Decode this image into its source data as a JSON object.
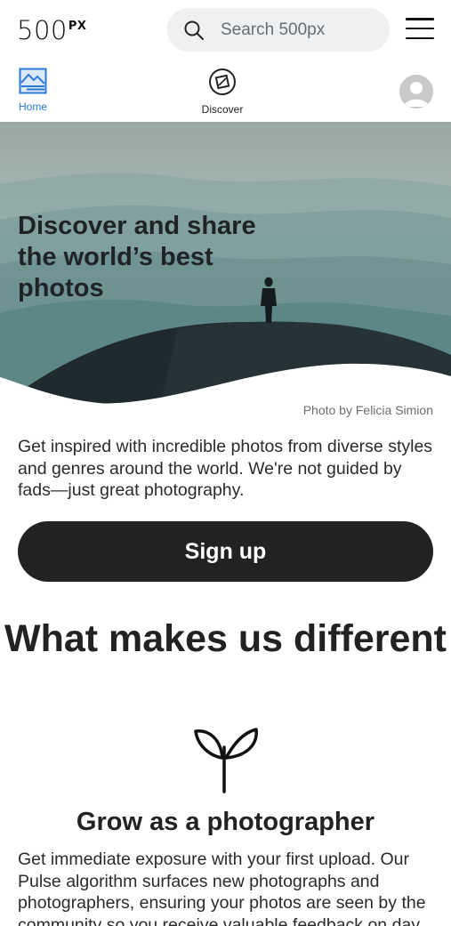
{
  "header": {
    "logo_main": "500",
    "logo_sup": "PX",
    "search_placeholder": "Search 500px",
    "icons": {
      "search": "search-icon",
      "menu": "hamburger-menu-icon"
    }
  },
  "nav": {
    "home_label": "Home",
    "discover_label": "Discover",
    "home_icon": "home-landscape-icon",
    "discover_icon": "discover-compass-icon",
    "avatar_icon": "user-avatar-icon",
    "active_color": "#2c7ad6"
  },
  "hero": {
    "title": "Discover and share the world’s best photos",
    "credit": "Photo by Felicia Simion"
  },
  "intro": {
    "text": "Get inspired with incredible photos from diverse styles and genres around the world. We're not guided by fads—just great photography."
  },
  "cta": {
    "signup_label": "Sign up",
    "color": "#222222"
  },
  "features": {
    "section_title": "What makes us different",
    "items": [
      {
        "icon": "sprout-icon",
        "title": "Grow as a photographer",
        "text": "Get immediate exposure with your first upload. Our Pulse algorithm surfaces new photographs and photographers, ensuring your photos are seen by the community so you receive valuable feedback on day"
      }
    ]
  }
}
